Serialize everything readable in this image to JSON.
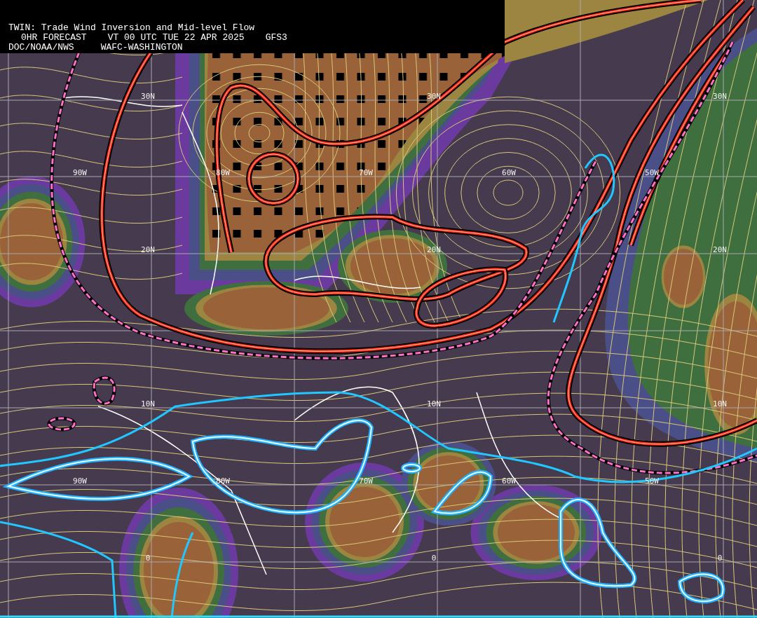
{
  "header": {
    "title": "TWIN: Trade Wind Inversion and Mid-level Flow",
    "forecast": "0HR FORECAST",
    "valid_time": "VT 00 UTC TUE 22 APR 2025",
    "model": "GFS3",
    "agency": "DOC/NOAA/NWS",
    "center": "WAFC-WASHINGTON"
  },
  "map": {
    "label_rows": [
      {
        "kind": "latitude",
        "labels": [
          "30N",
          "30N",
          "30N"
        ]
      },
      {
        "kind": "longitude",
        "labels": [
          "90W",
          "80W",
          "70W",
          "60W",
          "50W"
        ]
      },
      {
        "kind": "latitude",
        "labels": [
          "20N",
          "20N",
          "20N"
        ]
      },
      {
        "kind": "latitude",
        "labels": [
          "10N",
          "10N",
          "10N"
        ]
      },
      {
        "kind": "longitude",
        "labels": [
          "90W",
          "80W",
          "70W",
          "60W",
          "50W"
        ]
      },
      {
        "kind": "latitude",
        "labels": [
          "0",
          "0",
          "0"
        ]
      }
    ]
  }
}
